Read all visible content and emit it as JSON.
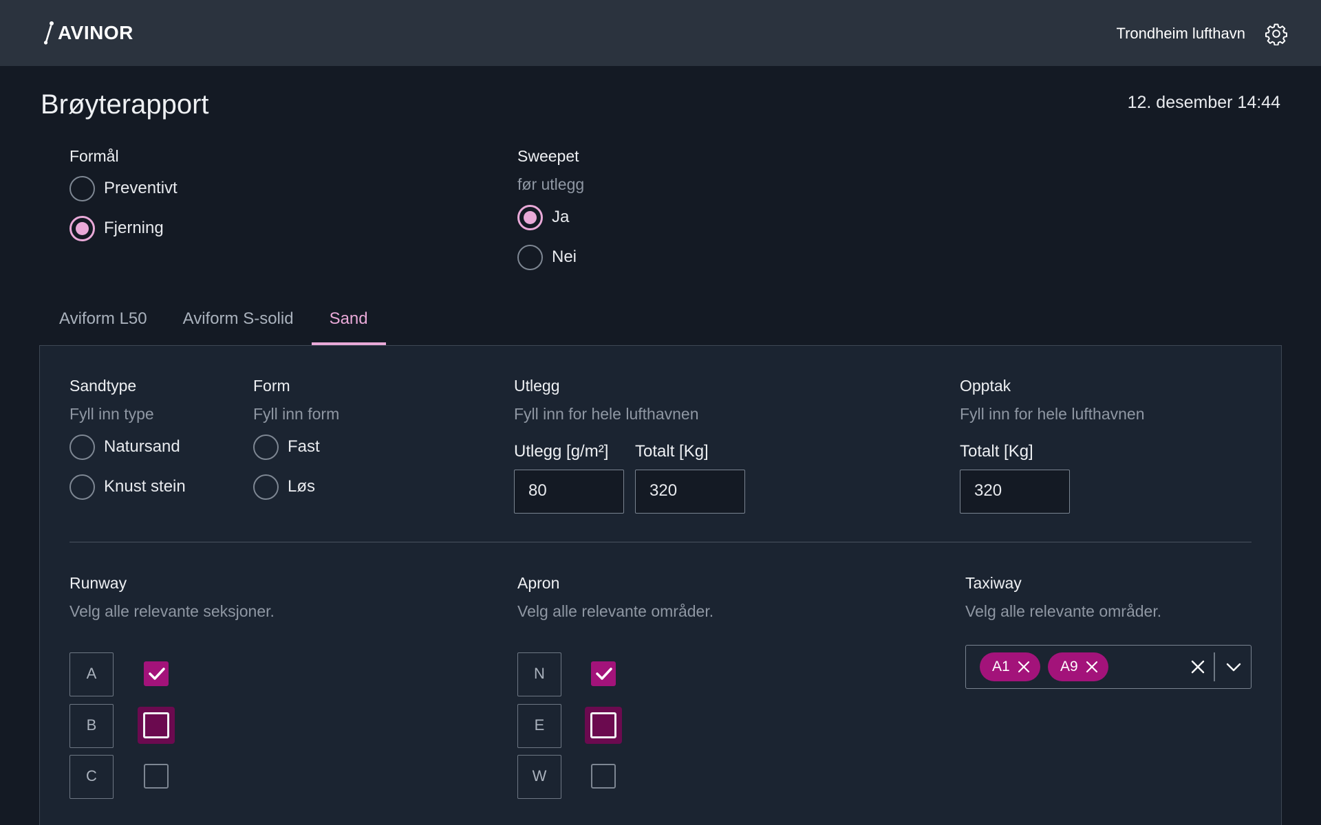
{
  "header": {
    "logo_text": "AVINOR",
    "airport": "Trondheim lufthavn",
    "settings_icon": "gear-icon"
  },
  "page": {
    "title": "Brøyterapport",
    "datetime": "12. desember 14:44"
  },
  "formal": {
    "title": "Formål",
    "options": [
      {
        "label": "Preventivt",
        "checked": false
      },
      {
        "label": "Fjerning",
        "checked": true
      }
    ]
  },
  "sweepet": {
    "title": "Sweepet",
    "subtitle": "før utlegg",
    "options": [
      {
        "label": "Ja",
        "checked": true
      },
      {
        "label": "Nei",
        "checked": false
      }
    ]
  },
  "tabs": [
    {
      "label": "Aviform L50",
      "active": false
    },
    {
      "label": "Aviform S-solid",
      "active": false
    },
    {
      "label": "Sand",
      "active": true
    }
  ],
  "sandtype": {
    "title": "Sandtype",
    "subtitle": "Fyll inn type",
    "options": [
      {
        "label": "Natursand",
        "checked": false
      },
      {
        "label": "Knust stein",
        "checked": false
      }
    ]
  },
  "form": {
    "title": "Form",
    "subtitle": "Fyll inn form",
    "options": [
      {
        "label": "Fast",
        "checked": false
      },
      {
        "label": "Løs",
        "checked": false
      }
    ]
  },
  "utlegg": {
    "title": "Utlegg",
    "subtitle": "Fyll inn for hele lufthavnen",
    "rate_label": "Utlegg [g/m²]",
    "rate_value": "80",
    "total_label": "Totalt [Kg]",
    "total_value": "320"
  },
  "opptak": {
    "title": "Opptak",
    "subtitle": "Fyll inn for hele lufthavnen",
    "total_label": "Totalt [Kg]",
    "total_value": "320"
  },
  "runway": {
    "title": "Runway",
    "subtitle": "Velg alle relevante seksjoner.",
    "sections": [
      {
        "label": "A",
        "checked": true,
        "focused": false
      },
      {
        "label": "B",
        "checked": false,
        "focused": true
      },
      {
        "label": "C",
        "checked": false,
        "focused": false
      }
    ]
  },
  "apron": {
    "title": "Apron",
    "subtitle": "Velg alle relevante områder.",
    "sections": [
      {
        "label": "N",
        "checked": true,
        "focused": false
      },
      {
        "label": "E",
        "checked": false,
        "focused": true
      },
      {
        "label": "W",
        "checked": false,
        "focused": false
      }
    ]
  },
  "taxiway": {
    "title": "Taxiway",
    "subtitle": "Velg alle relevante områder.",
    "selected": [
      "A1",
      "A9"
    ]
  },
  "colors": {
    "accent": "#e9a9d8",
    "brand_magenta": "#a3137a",
    "focus_bg": "#6b0a4f",
    "background": "#141a24",
    "panel": "#1b2431",
    "topbar": "#2b333e"
  }
}
